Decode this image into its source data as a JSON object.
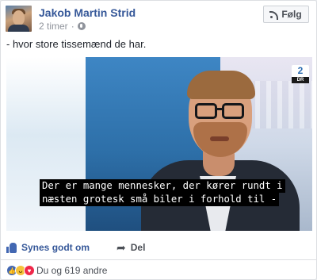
{
  "post": {
    "author": "Jakob Martin Strid",
    "time": "2 timer",
    "separator": "·",
    "follow_label": "Følg",
    "caption": "- hvor store tissemænd de har.",
    "video": {
      "channel_number": "2",
      "channel_name": "DR",
      "subtitle_line1": "Der er mange mennesker, der kører rundt i",
      "subtitle_line2": "næsten grotesk små biler i forhold til -"
    },
    "actions": {
      "like_label": "Synes godt om",
      "share_label": "Del"
    },
    "reactions": {
      "summary": "Du og 619 andre",
      "types": [
        "like",
        "haha",
        "love"
      ]
    }
  },
  "colors": {
    "link_blue": "#365899",
    "fb_blue": "#4267b2",
    "meta_gray": "#90949c"
  },
  "icons": [
    "globe-icon",
    "rss-icon",
    "like-icon",
    "share-icon"
  ]
}
